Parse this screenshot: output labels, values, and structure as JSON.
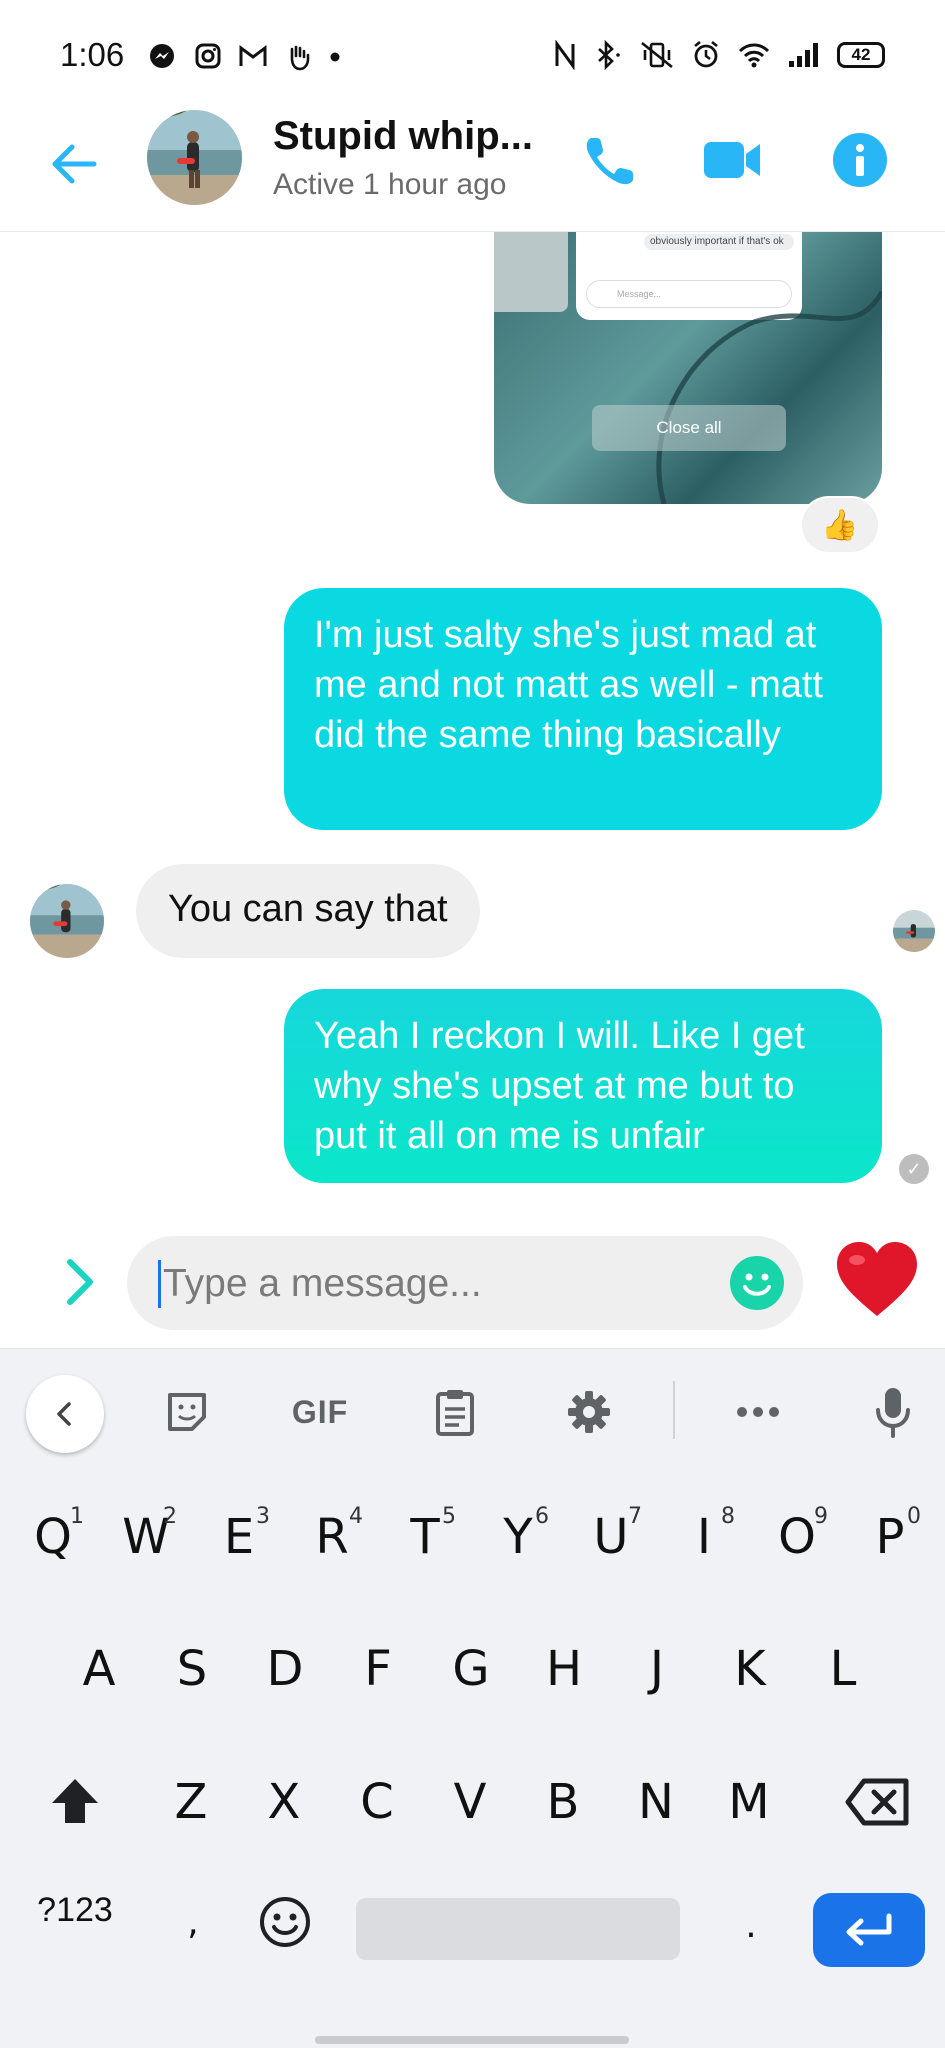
{
  "status_bar": {
    "time": "1:06",
    "battery": "42"
  },
  "header": {
    "contact_name": "Stupid whip...",
    "contact_status": "Active 1 hour ago"
  },
  "shared_screenshot": {
    "preview_text": "obviously important if that's ok",
    "preview_input": "Message...",
    "close_all_label": "Close all"
  },
  "reaction": "👍",
  "messages": [
    {
      "direction": "out",
      "text": "I'm just salty she's just mad at me and not matt as well - matt did the same thing basically"
    },
    {
      "direction": "in",
      "text": "You can say that"
    },
    {
      "direction": "out",
      "text": "Yeah I reckon I will. Like I get why she's upset at me but to put it all on me is unfair"
    }
  ],
  "composer": {
    "placeholder": "Type a message..."
  },
  "keyboard": {
    "toolbar": {
      "gif_label": "GIF"
    },
    "row1": [
      {
        "key": "Q",
        "hint": "1"
      },
      {
        "key": "W",
        "hint": "2"
      },
      {
        "key": "E",
        "hint": "3"
      },
      {
        "key": "R",
        "hint": "4"
      },
      {
        "key": "T",
        "hint": "5"
      },
      {
        "key": "Y",
        "hint": "6"
      },
      {
        "key": "U",
        "hint": "7"
      },
      {
        "key": "I",
        "hint": "8"
      },
      {
        "key": "O",
        "hint": "9"
      },
      {
        "key": "P",
        "hint": "0"
      }
    ],
    "row2": [
      "A",
      "S",
      "D",
      "F",
      "G",
      "H",
      "J",
      "K",
      "L"
    ],
    "row3": [
      "Z",
      "X",
      "C",
      "V",
      "B",
      "N",
      "M"
    ],
    "symbols_label": "?123",
    "comma": ",",
    "period": "."
  },
  "colors": {
    "accent": "#0bd9e2",
    "outgoing_bubble": "#0bd9e2",
    "incoming_bubble": "#efefef",
    "enter_key": "#1a73e8"
  }
}
